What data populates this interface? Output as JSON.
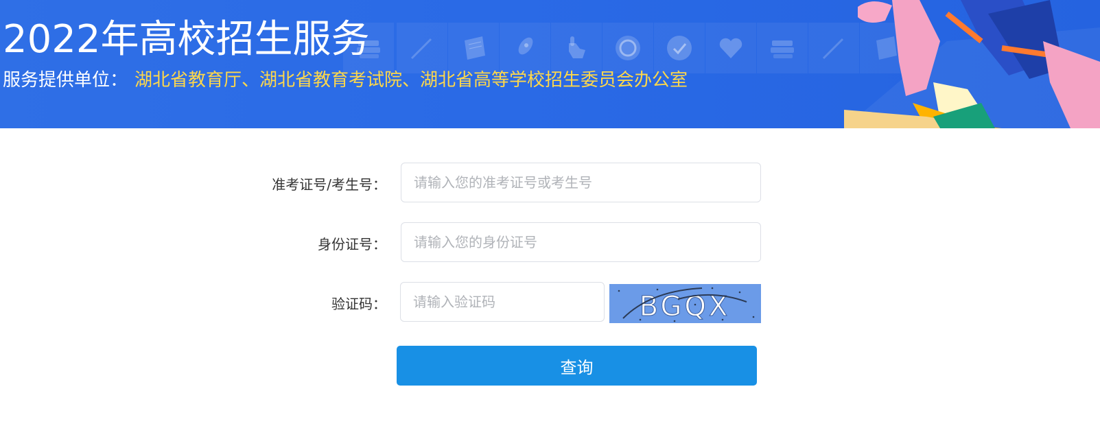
{
  "banner": {
    "title": "2022年高校招生服务",
    "provider_label": "服务提供单位：",
    "provider_orgs": "湖北省教育厅、湖北省教育考试院、湖北省高等学校招生委员会办公室",
    "colors": {
      "background": "#2a6ae6",
      "highlight": "#ffd84a"
    }
  },
  "form": {
    "exam_id": {
      "label": "准考证号/考生号：",
      "placeholder": "请输入您的准考证号或考生号",
      "value": ""
    },
    "id_card": {
      "label": "身份证号：",
      "placeholder": "请输入您的身份证号",
      "value": ""
    },
    "captcha": {
      "label": "验证码：",
      "placeholder": "请输入验证码",
      "value": "",
      "image_text": "BGQX"
    },
    "submit_label": "查询",
    "colors": {
      "button": "#1890e5",
      "captcha_bg": "#6b9be8"
    }
  },
  "icons": [
    "books-icon",
    "pencil-icon",
    "paper-icon",
    "rocket-icon",
    "hand-icon",
    "smile-icon",
    "check-icon",
    "heart-icon",
    "books-icon",
    "pencil-icon",
    "paper-icon"
  ]
}
